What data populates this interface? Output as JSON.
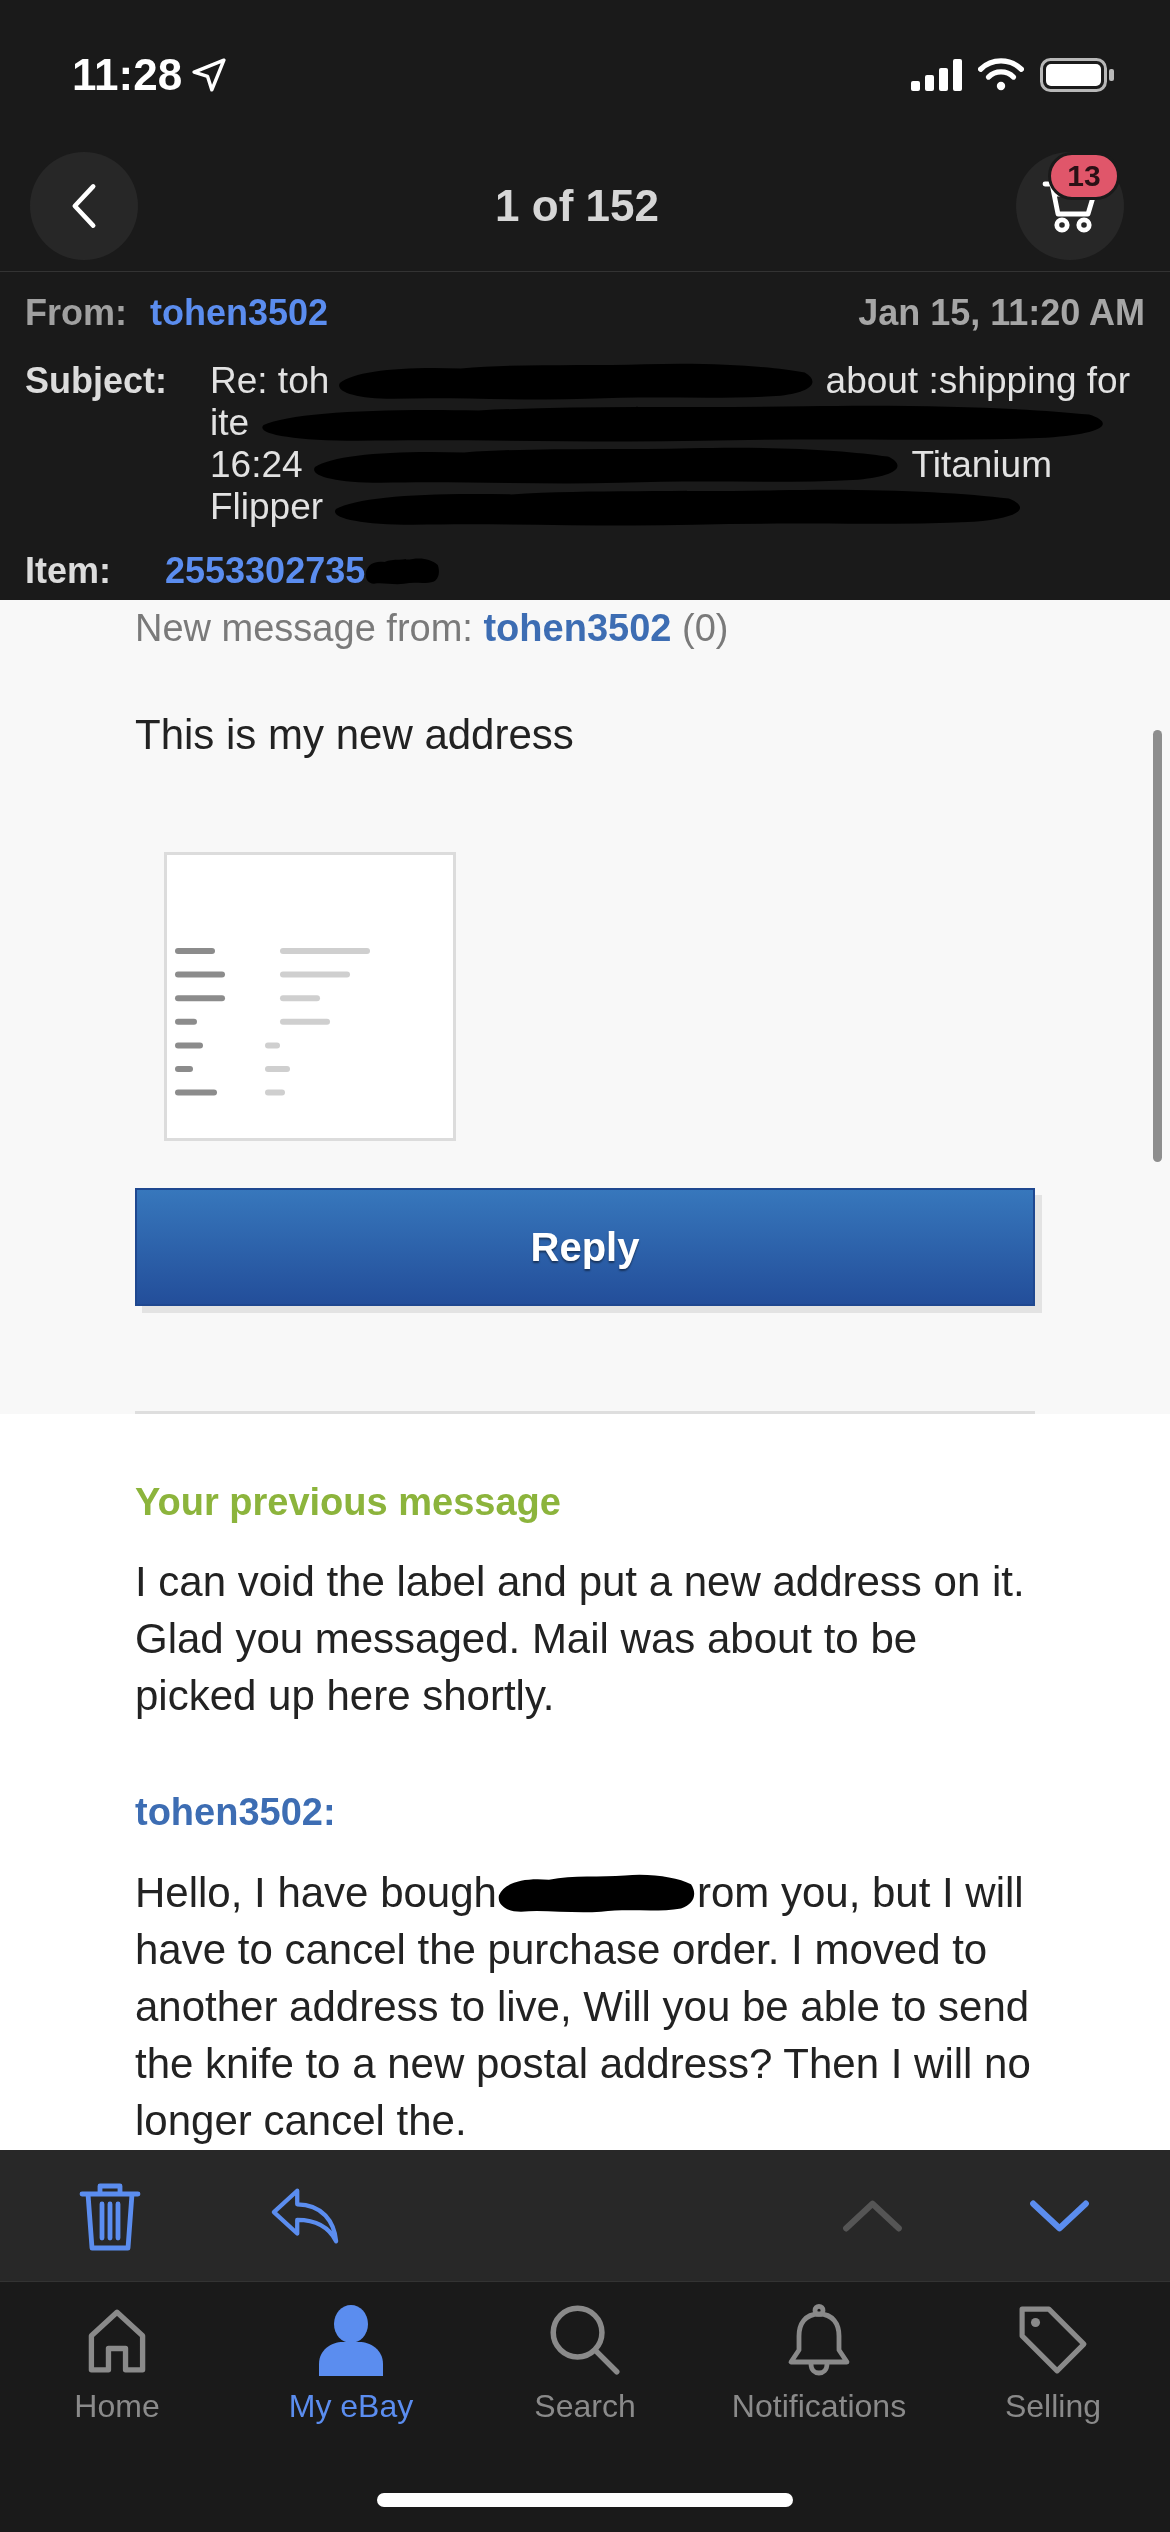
{
  "status_bar": {
    "time": "11:28"
  },
  "nav": {
    "title": "1 of 152",
    "cart_badge": "13"
  },
  "header": {
    "from_label": "From:",
    "from": "tohen3502",
    "date": "Jan 15, 11:20 AM",
    "subject_label": "Subject:",
    "subject_lines": [
      {
        "before": "Re: toh",
        "after": "about :shipping for"
      },
      {
        "before": "ite"
      },
      {
        "before": "16:24",
        "after": "Titanium"
      },
      {
        "before": "Flipper"
      }
    ],
    "item_label": "Item:",
    "item": "2553302735"
  },
  "new_message": {
    "intro": "New message from:",
    "sender": "tohen3502",
    "feedback": "(0)",
    "body": "This is my new address",
    "reply_button": "Reply"
  },
  "previous_message": {
    "heading": "Your previous message",
    "body": "I can void the label and put a new address on it. Glad you messaged. Mail was about to be picked up here shortly.",
    "sender": "tohen3502:",
    "body_before_redaction": "Hello, I have bough",
    "body_after_redaction": "rom you, but I will",
    "body_rest": "have to cancel the purchase order. I moved to another address to live, Will you be able to send the knife to a new postal address? Then I will no longer cancel the."
  },
  "toolbar": [
    {
      "kind": "delete",
      "disabled": false
    },
    {
      "kind": "reply",
      "disabled": false
    },
    {
      "kind": "previous",
      "disabled": true
    },
    {
      "kind": "next",
      "disabled": false
    }
  ],
  "tabs": [
    {
      "label": "Home",
      "selected": false
    },
    {
      "label": "My eBay",
      "selected": true
    },
    {
      "label": "Search",
      "selected": false
    },
    {
      "label": "Notifications",
      "selected": false
    },
    {
      "label": "Selling",
      "selected": false
    }
  ]
}
